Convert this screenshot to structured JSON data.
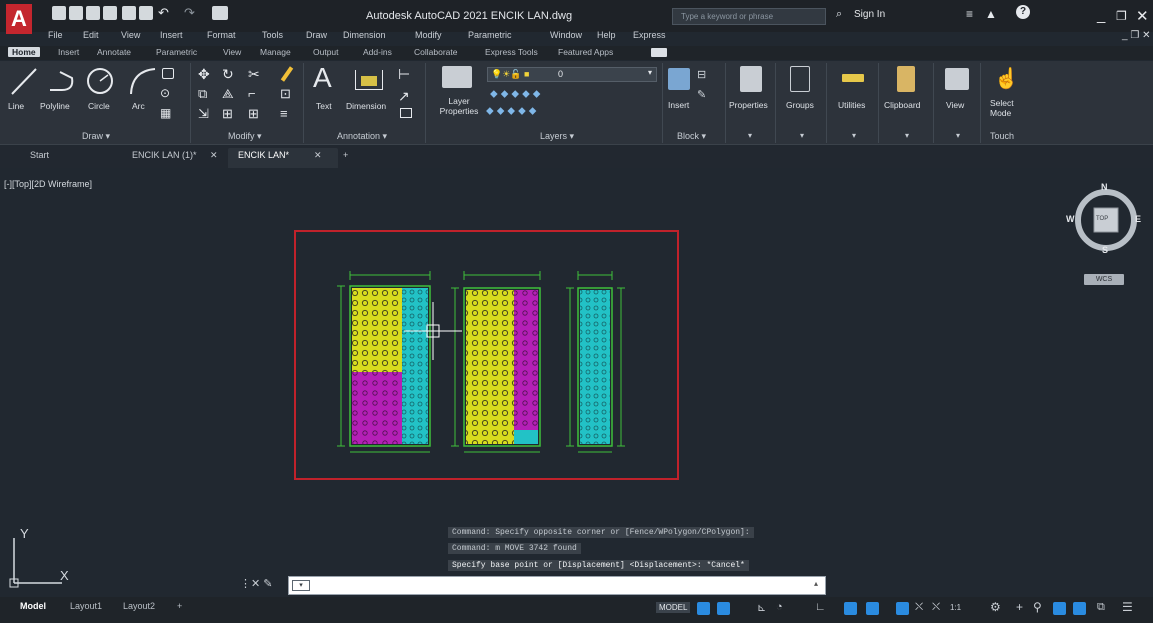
{
  "app": {
    "title": "Autodesk AutoCAD 2021   ENCIK LAN.dwg",
    "search_placeholder": "Type a keyword or phrase",
    "sign_in": "Sign In",
    "logo": "A"
  },
  "menu": [
    "File",
    "Edit",
    "View",
    "Insert",
    "Format",
    "Tools",
    "Draw",
    "Dimension",
    "Modify",
    "Parametric",
    "Window",
    "Help",
    "Express"
  ],
  "ribbon_tabs": [
    "Home",
    "Insert",
    "Annotate",
    "Parametric",
    "View",
    "Manage",
    "Output",
    "Add-ins",
    "Collaborate",
    "Express Tools",
    "Featured Apps"
  ],
  "ribbon": {
    "draw_tools": [
      "Line",
      "Polyline",
      "Circle",
      "Arc"
    ],
    "draw_panel": "Draw ▾",
    "modify_panel": "Modify ▾",
    "text_label": "Text",
    "dimension_label": "Dimension",
    "annotation_panel": "Annotation ▾",
    "layer_properties": "Layer Properties",
    "layer_value": "0",
    "layers_panel": "Layers ▾",
    "insert_label": "Insert",
    "block_panel": "Block ▾",
    "properties_label": "Properties",
    "groups_label": "Groups",
    "utilities_label": "Utilities",
    "clipboard_label": "Clipboard",
    "view_label": "View",
    "select_mode_label": "Select Mode",
    "touch_panel": "Touch"
  },
  "doc_tabs": [
    "Start",
    "ENCIK LAN (1)*",
    "ENCIK LAN*"
  ],
  "viewport": {
    "label": "[-][Top][2D Wireframe]",
    "compass": {
      "n": "N",
      "s": "S",
      "e": "E",
      "w": "W",
      "cube": "TOP",
      "wcs": "WCS"
    },
    "ucs_x": "X",
    "ucs_y": "Y"
  },
  "command": {
    "history": [
      "Command: Specify opposite corner or [Fence/WPolygon/CPolygon]:",
      "Command: m MOVE 3742 found",
      "Specify base point or [Displacement] <Displacement>: *Cancel*"
    ],
    "input_placeholder": ""
  },
  "layout_tabs": [
    "Model",
    "Layout1",
    "Layout2"
  ],
  "status": {
    "model": "MODEL",
    "scale": "1:1"
  },
  "colors": {
    "yellow": "#d8dc1e",
    "magenta": "#b41fb6",
    "cyan": "#22c2c6",
    "green": "#3fbf3a",
    "red": "#c0222b",
    "accent": "#2a8be0"
  }
}
